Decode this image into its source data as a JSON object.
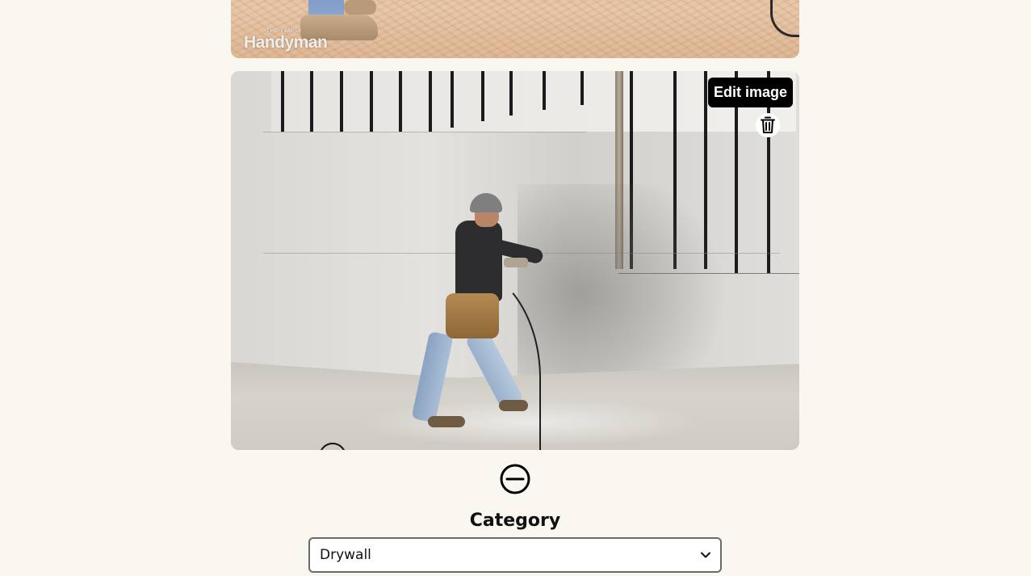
{
  "top_image": {
    "watermark_small": "THE FAMILY",
    "watermark_brand": "Handyman"
  },
  "main_image": {
    "edit_label": "Edit image",
    "delete_icon": "trash-icon",
    "drag_icon": "circle-handle-icon"
  },
  "remove_icon": "minus-circle-icon",
  "category": {
    "label": "Category",
    "selected": "Drywall"
  }
}
